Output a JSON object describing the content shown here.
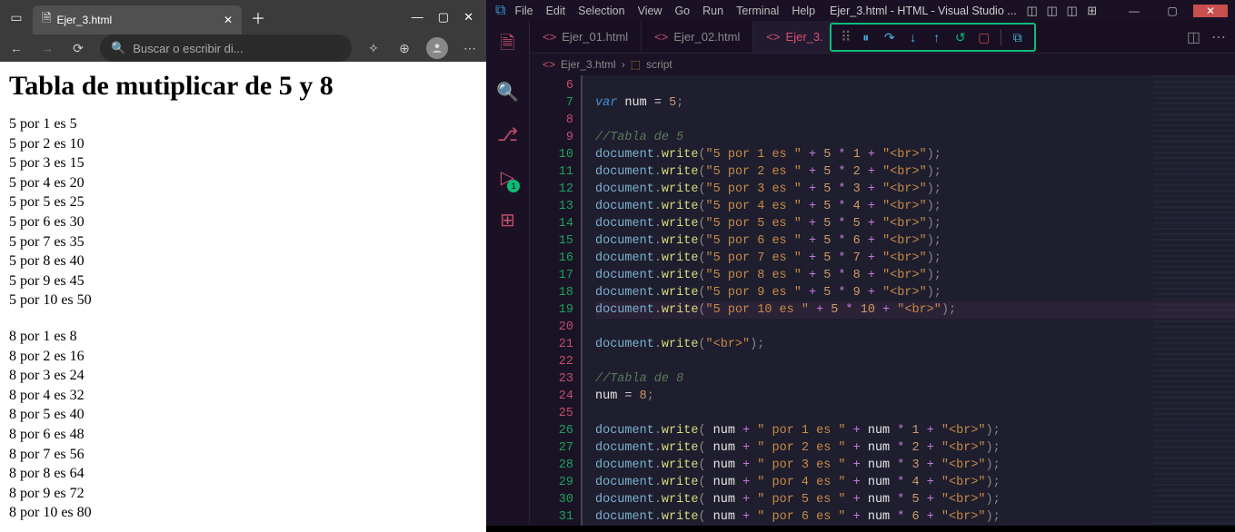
{
  "browser": {
    "tab_title": "Ejer_3.html",
    "addr_placeholder": "Buscar o escribir di...",
    "page_title": "Tabla de mutiplicar de 5 y 8",
    "table5": [
      "5 por 1 es 5",
      "5 por 2 es 10",
      "5 por 3 es 15",
      "5 por 4 es 20",
      "5 por 5 es 25",
      "5 por 6 es 30",
      "5 por 7 es 35",
      "5 por 8 es 40",
      "5 por 9 es 45",
      "5 por 10 es 50"
    ],
    "table8": [
      "8 por 1 es 8",
      "8 por 2 es 16",
      "8 por 3 es 24",
      "8 por 4 es 32",
      "8 por 5 es 40",
      "8 por 6 es 48",
      "8 por 7 es 56",
      "8 por 8 es 64",
      "8 por 9 es 72",
      "8 por 10 es 80"
    ]
  },
  "vscode": {
    "menu": [
      "File",
      "Edit",
      "Selection",
      "View",
      "Go",
      "Run",
      "Terminal",
      "Help"
    ],
    "window_title": "Ejer_3.html - HTML - Visual Studio ...",
    "tabs": [
      "Ejer_01.html",
      "Ejer_02.html",
      "Ejer_3."
    ],
    "active_tab_index": 2,
    "activity_badge": "1",
    "breadcrumb_file": "Ejer_3.html",
    "breadcrumb_symbol": "script",
    "line_numbers": [
      6,
      7,
      8,
      9,
      10,
      11,
      12,
      13,
      14,
      15,
      16,
      17,
      18,
      19,
      20,
      21,
      22,
      23,
      24,
      25,
      26,
      27,
      28,
      29,
      30,
      31
    ],
    "green_lines": [
      7,
      10,
      11,
      12,
      13,
      14,
      15,
      16,
      17,
      18,
      19,
      26,
      27,
      28,
      29,
      30,
      31
    ],
    "red_lines": [
      6,
      8,
      9,
      20,
      21,
      22,
      23,
      24,
      25
    ],
    "highlight_line": 19,
    "code_rows": [
      {
        "n": 6,
        "html": ""
      },
      {
        "n": 7,
        "html": "<span class='tk-kw'>var</span> <span class='tk-var'>num</span> <span class='tk-op'>=</span> <span class='tk-num'>5</span><span class='tk-punc'>;</span>"
      },
      {
        "n": 8,
        "html": ""
      },
      {
        "n": 9,
        "html": "<span class='tk-cmt'>//Tabla de 5</span>"
      },
      {
        "n": 10,
        "html": "<span class='tk-obj'>document</span><span class='tk-punc'>.</span><span class='tk-fn'>write</span><span class='tk-punc'>(</span><span class='tk-str'>\"5 por 1 es \"</span> <span class='tk-plus'>+</span> <span class='tk-num'>5</span> <span class='tk-star'>*</span> <span class='tk-num'>1</span> <span class='tk-plus'>+</span> <span class='tk-str'>\"&lt;br&gt;\"</span><span class='tk-punc'>);</span>"
      },
      {
        "n": 11,
        "html": "<span class='tk-obj'>document</span><span class='tk-punc'>.</span><span class='tk-fn'>write</span><span class='tk-punc'>(</span><span class='tk-str'>\"5 por 2 es \"</span> <span class='tk-plus'>+</span> <span class='tk-num'>5</span> <span class='tk-star'>*</span> <span class='tk-num'>2</span> <span class='tk-plus'>+</span> <span class='tk-str'>\"&lt;br&gt;\"</span><span class='tk-punc'>);</span>"
      },
      {
        "n": 12,
        "html": "<span class='tk-obj'>document</span><span class='tk-punc'>.</span><span class='tk-fn'>write</span><span class='tk-punc'>(</span><span class='tk-str'>\"5 por 3 es \"</span> <span class='tk-plus'>+</span> <span class='tk-num'>5</span> <span class='tk-star'>*</span> <span class='tk-num'>3</span> <span class='tk-plus'>+</span> <span class='tk-str'>\"&lt;br&gt;\"</span><span class='tk-punc'>);</span>"
      },
      {
        "n": 13,
        "html": "<span class='tk-obj'>document</span><span class='tk-punc'>.</span><span class='tk-fn'>write</span><span class='tk-punc'>(</span><span class='tk-str'>\"5 por 4 es \"</span> <span class='tk-plus'>+</span> <span class='tk-num'>5</span> <span class='tk-star'>*</span> <span class='tk-num'>4</span> <span class='tk-plus'>+</span> <span class='tk-str'>\"&lt;br&gt;\"</span><span class='tk-punc'>);</span>"
      },
      {
        "n": 14,
        "html": "<span class='tk-obj'>document</span><span class='tk-punc'>.</span><span class='tk-fn'>write</span><span class='tk-punc'>(</span><span class='tk-str'>\"5 por 5 es \"</span> <span class='tk-plus'>+</span> <span class='tk-num'>5</span> <span class='tk-star'>*</span> <span class='tk-num'>5</span> <span class='tk-plus'>+</span> <span class='tk-str'>\"&lt;br&gt;\"</span><span class='tk-punc'>);</span>"
      },
      {
        "n": 15,
        "html": "<span class='tk-obj'>document</span><span class='tk-punc'>.</span><span class='tk-fn'>write</span><span class='tk-punc'>(</span><span class='tk-str'>\"5 por 6 es \"</span> <span class='tk-plus'>+</span> <span class='tk-num'>5</span> <span class='tk-star'>*</span> <span class='tk-num'>6</span> <span class='tk-plus'>+</span> <span class='tk-str'>\"&lt;br&gt;\"</span><span class='tk-punc'>);</span>"
      },
      {
        "n": 16,
        "html": "<span class='tk-obj'>document</span><span class='tk-punc'>.</span><span class='tk-fn'>write</span><span class='tk-punc'>(</span><span class='tk-str'>\"5 por 7 es \"</span> <span class='tk-plus'>+</span> <span class='tk-num'>5</span> <span class='tk-star'>*</span> <span class='tk-num'>7</span> <span class='tk-plus'>+</span> <span class='tk-str'>\"&lt;br&gt;\"</span><span class='tk-punc'>);</span>"
      },
      {
        "n": 17,
        "html": "<span class='tk-obj'>document</span><span class='tk-punc'>.</span><span class='tk-fn'>write</span><span class='tk-punc'>(</span><span class='tk-str'>\"5 por 8 es \"</span> <span class='tk-plus'>+</span> <span class='tk-num'>5</span> <span class='tk-star'>*</span> <span class='tk-num'>8</span> <span class='tk-plus'>+</span> <span class='tk-str'>\"&lt;br&gt;\"</span><span class='tk-punc'>);</span>"
      },
      {
        "n": 18,
        "html": "<span class='tk-obj'>document</span><span class='tk-punc'>.</span><span class='tk-fn'>write</span><span class='tk-punc'>(</span><span class='tk-str'>\"5 por 9 es \"</span> <span class='tk-plus'>+</span> <span class='tk-num'>5</span> <span class='tk-star'>*</span> <span class='tk-num'>9</span> <span class='tk-plus'>+</span> <span class='tk-str'>\"&lt;br&gt;\"</span><span class='tk-punc'>);</span>"
      },
      {
        "n": 19,
        "html": "<span class='tk-obj'>document</span><span class='tk-punc'>.</span><span class='tk-fn'>write</span><span class='tk-punc'>(</span><span class='tk-str'>\"5 por 10 es \"</span> <span class='tk-plus'>+</span> <span class='tk-num'>5</span> <span class='tk-star'>*</span> <span class='tk-num'>10</span> <span class='tk-plus'>+</span> <span class='tk-str'>\"&lt;br&gt;\"</span><span class='tk-punc'>);</span>"
      },
      {
        "n": 20,
        "html": ""
      },
      {
        "n": 21,
        "html": "<span class='tk-obj'>document</span><span class='tk-punc'>.</span><span class='tk-fn'>write</span><span class='tk-punc'>(</span><span class='tk-str'>\"&lt;br&gt;\"</span><span class='tk-punc'>);</span>"
      },
      {
        "n": 22,
        "html": ""
      },
      {
        "n": 23,
        "html": "<span class='tk-cmt'>//Tabla de 8</span>"
      },
      {
        "n": 24,
        "html": "<span class='tk-var'>num</span> <span class='tk-op'>=</span> <span class='tk-num'>8</span><span class='tk-punc'>;</span>"
      },
      {
        "n": 25,
        "html": ""
      },
      {
        "n": 26,
        "html": "<span class='tk-obj'>document</span><span class='tk-punc'>.</span><span class='tk-fn'>write</span><span class='tk-punc'>(</span> <span class='tk-var'>num</span> <span class='tk-plus'>+</span> <span class='tk-str'>\" por 1 es \"</span> <span class='tk-plus'>+</span> <span class='tk-var'>num</span> <span class='tk-star'>*</span> <span class='tk-num'>1</span> <span class='tk-plus'>+</span> <span class='tk-str'>\"&lt;br&gt;\"</span><span class='tk-punc'>);</span>"
      },
      {
        "n": 27,
        "html": "<span class='tk-obj'>document</span><span class='tk-punc'>.</span><span class='tk-fn'>write</span><span class='tk-punc'>(</span> <span class='tk-var'>num</span> <span class='tk-plus'>+</span> <span class='tk-str'>\" por 2 es \"</span> <span class='tk-plus'>+</span> <span class='tk-var'>num</span> <span class='tk-star'>*</span> <span class='tk-num'>2</span> <span class='tk-plus'>+</span> <span class='tk-str'>\"&lt;br&gt;\"</span><span class='tk-punc'>);</span>"
      },
      {
        "n": 28,
        "html": "<span class='tk-obj'>document</span><span class='tk-punc'>.</span><span class='tk-fn'>write</span><span class='tk-punc'>(</span> <span class='tk-var'>num</span> <span class='tk-plus'>+</span> <span class='tk-str'>\" por 3 es \"</span> <span class='tk-plus'>+</span> <span class='tk-var'>num</span> <span class='tk-star'>*</span> <span class='tk-num'>3</span> <span class='tk-plus'>+</span> <span class='tk-str'>\"&lt;br&gt;\"</span><span class='tk-punc'>);</span>"
      },
      {
        "n": 29,
        "html": "<span class='tk-obj'>document</span><span class='tk-punc'>.</span><span class='tk-fn'>write</span><span class='tk-punc'>(</span> <span class='tk-var'>num</span> <span class='tk-plus'>+</span> <span class='tk-str'>\" por 4 es \"</span> <span class='tk-plus'>+</span> <span class='tk-var'>num</span> <span class='tk-star'>*</span> <span class='tk-num'>4</span> <span class='tk-plus'>+</span> <span class='tk-str'>\"&lt;br&gt;\"</span><span class='tk-punc'>);</span>"
      },
      {
        "n": 30,
        "html": "<span class='tk-obj'>document</span><span class='tk-punc'>.</span><span class='tk-fn'>write</span><span class='tk-punc'>(</span> <span class='tk-var'>num</span> <span class='tk-plus'>+</span> <span class='tk-str'>\" por 5 es \"</span> <span class='tk-plus'>+</span> <span class='tk-var'>num</span> <span class='tk-star'>*</span> <span class='tk-num'>5</span> <span class='tk-plus'>+</span> <span class='tk-str'>\"&lt;br&gt;\"</span><span class='tk-punc'>);</span>"
      },
      {
        "n": 31,
        "html": "<span class='tk-obj'>document</span><span class='tk-punc'>.</span><span class='tk-fn'>write</span><span class='tk-punc'>(</span> <span class='tk-var'>num</span> <span class='tk-plus'>+</span> <span class='tk-str'>\" por 6 es \"</span> <span class='tk-plus'>+</span> <span class='tk-var'>num</span> <span class='tk-star'>*</span> <span class='tk-num'>6</span> <span class='tk-plus'>+</span> <span class='tk-str'>\"&lt;br&gt;\"</span><span class='tk-punc'>);</span>"
      }
    ]
  }
}
